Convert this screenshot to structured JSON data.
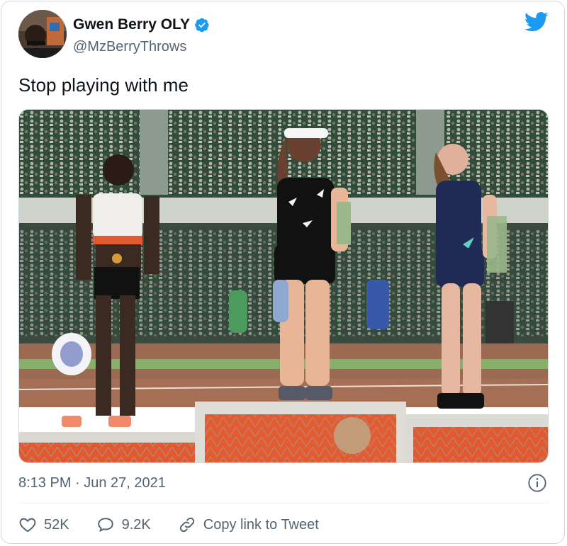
{
  "tweet": {
    "author": {
      "display_name": "Gwen Berry OLY",
      "handle": "@MzBerryThrows",
      "verified": true,
      "avatar_icon": "profile-photo"
    },
    "brand_icon": "twitter-bird-icon",
    "brand_color": "#1d9bf0",
    "text": "Stop playing with me",
    "media": {
      "type": "photo"
    },
    "timestamp": "8:13 PM · Jun 27, 2021",
    "actions": {
      "like_count": "52K",
      "reply_count": "9.2K",
      "share_label": "Copy link to Tweet"
    }
  }
}
